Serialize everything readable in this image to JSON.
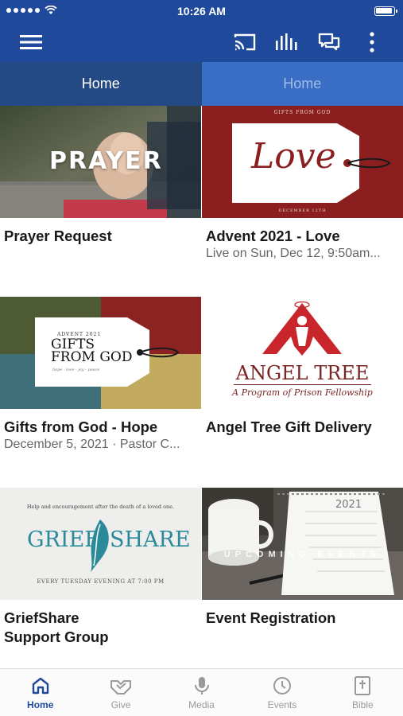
{
  "status_bar": {
    "time": "10:26 AM"
  },
  "tabs": [
    {
      "label": "Home"
    },
    {
      "label": "Home"
    }
  ],
  "cards": [
    {
      "title": "Prayer Request",
      "subtitle": "",
      "thumb_text": "PRAYER"
    },
    {
      "title": "Advent 2021 - Love",
      "subtitle": "Live on Sun, Dec 12, 9:50am...",
      "thumb_text": "Love",
      "thumb_small": "GIFTS FROM GOD",
      "thumb_footer": "DECEMBER 12TH"
    },
    {
      "title": "Gifts from God - Hope",
      "subtitle": "December 5, 2021 · Pastor C...",
      "thumb_text": "GIFTS FROM GOD",
      "thumb_small": "ADVENT 2021",
      "thumb_footer": "hope · love · joy · peace"
    },
    {
      "title": "Angel Tree Gift Delivery",
      "subtitle": "",
      "thumb_text": "ANGEL TREE",
      "thumb_small": "A Program of Prison Fellowship"
    },
    {
      "title": "GriefShare",
      "title2": "Support Group",
      "subtitle": "",
      "thumb_small": "Help and encouragement after the death of a loved one.",
      "thumb_left": "GRIEF",
      "thumb_right": "SHARE",
      "thumb_footer": "EVERY TUESDAY EVENING AT 7:00 PM"
    },
    {
      "title": "Event Registration",
      "subtitle": "",
      "thumb_text": "UPCOMING EVENTS",
      "thumb_small": "2021"
    }
  ],
  "bottom_nav": [
    {
      "label": "Home",
      "icon": "home-icon",
      "active": true
    },
    {
      "label": "Give",
      "icon": "give-icon",
      "active": false
    },
    {
      "label": "Media",
      "icon": "microphone-icon",
      "active": false
    },
    {
      "label": "Events",
      "icon": "clock-icon",
      "active": false
    },
    {
      "label": "Bible",
      "icon": "bible-icon",
      "active": false
    }
  ],
  "colors": {
    "primary": "#1f4a9c",
    "tab_active": "#244a85",
    "tab_inactive": "#3a6ec4",
    "advent_red": "#8b1f1f",
    "angel_red": "#c8262b",
    "grief_teal": "#2a8a9a"
  }
}
